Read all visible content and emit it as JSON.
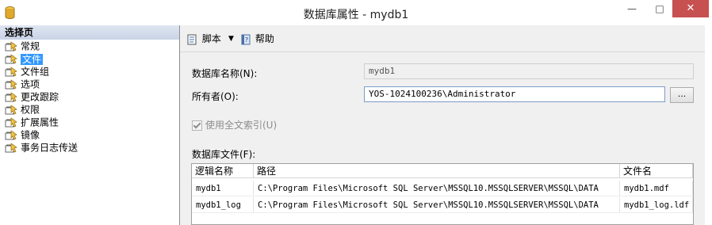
{
  "window": {
    "title": "数据库属性 - mydb1",
    "minimize": "—",
    "maximize": "□",
    "close": "✕"
  },
  "sidebar": {
    "header": "选择页",
    "items": [
      {
        "label": "常规",
        "selected": false
      },
      {
        "label": "文件",
        "selected": true
      },
      {
        "label": "文件组",
        "selected": false
      },
      {
        "label": "选项",
        "selected": false
      },
      {
        "label": "更改跟踪",
        "selected": false
      },
      {
        "label": "权限",
        "selected": false
      },
      {
        "label": "扩展属性",
        "selected": false
      },
      {
        "label": "镜像",
        "selected": false
      },
      {
        "label": "事务日志传送",
        "selected": false
      }
    ]
  },
  "toolbar": {
    "script_label": "脚本",
    "help_label": "帮助"
  },
  "form": {
    "db_name_label": "数据库名称(N):",
    "db_name_value": "mydb1",
    "owner_label": "所有者(O):",
    "owner_value": "YOS-1024100236\\Administrator",
    "browse_label": "...",
    "fulltext_label": "使用全文索引(U)",
    "fulltext_checked": true,
    "files_label": "数据库文件(F):"
  },
  "files_table": {
    "columns": [
      "逻辑名称",
      "路径",
      "文件名"
    ],
    "rows": [
      [
        "mydb1",
        "C:\\Program Files\\Microsoft SQL Server\\MSSQL10.MSSQLSERVER\\MSSQL\\DATA",
        "mydb1.mdf"
      ],
      [
        "mydb1_log",
        "C:\\Program Files\\Microsoft SQL Server\\MSSQL10.MSSQLSERVER\\MSSQL\\DATA",
        "mydb1_log.ldf"
      ]
    ]
  },
  "colors": {
    "selection": "#3399ff",
    "close_button": "#c75050",
    "panel_background": "#f0f0f0"
  }
}
